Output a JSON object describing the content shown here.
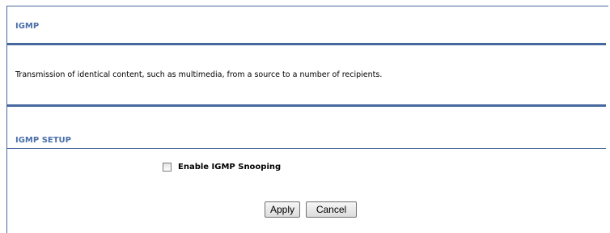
{
  "igmp": {
    "title": "IGMP",
    "description": "Transmission of identical content, such as multimedia, from a source to a number of recipients."
  },
  "setup": {
    "title": "IGMP SETUP",
    "snooping_label": "Enable IGMP Snooping",
    "snooping_checked": false
  },
  "buttons": {
    "apply_label": "Apply",
    "cancel_label": "Cancel"
  }
}
